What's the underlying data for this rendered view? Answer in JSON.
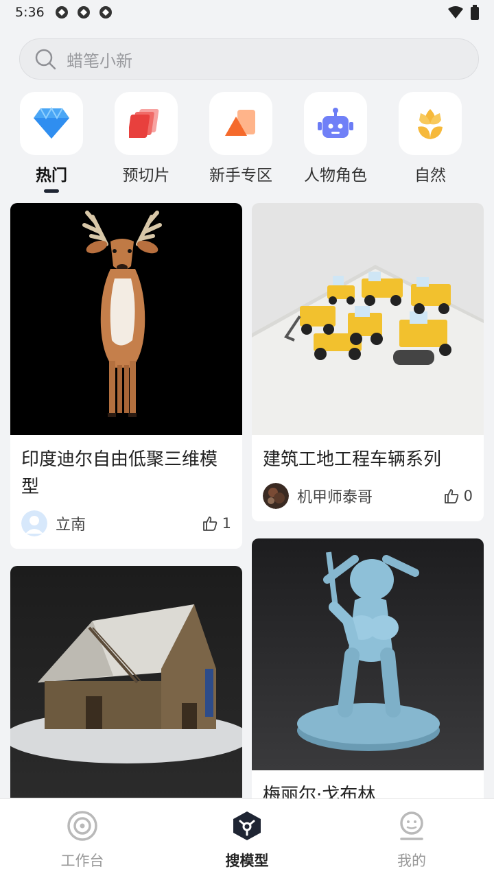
{
  "status_bar": {
    "time": "5:36"
  },
  "search": {
    "placeholder": "蜡笔小新"
  },
  "categories": [
    {
      "label": "热门",
      "icon": "diamond-icon",
      "active": true
    },
    {
      "label": "预切片",
      "icon": "slices-icon",
      "active": false
    },
    {
      "label": "新手专区",
      "icon": "cards-icon",
      "active": false
    },
    {
      "label": "人物角色",
      "icon": "robot-icon",
      "active": false
    },
    {
      "label": "自然",
      "icon": "tulip-icon",
      "active": false
    }
  ],
  "cards": [
    {
      "title": "印度迪尔自由低聚三维模型",
      "author": "立南",
      "likes": "1"
    },
    {
      "title": "建筑工地工程车辆系列",
      "author": "机甲师泰哥",
      "likes": "0"
    },
    {
      "title": "",
      "author": "",
      "likes": ""
    },
    {
      "title": "梅丽尔·戈布林",
      "author": "",
      "likes": ""
    }
  ],
  "bottom_nav": [
    {
      "label": "工作台",
      "icon": "workbench-icon",
      "active": false
    },
    {
      "label": "搜模型",
      "icon": "search-model-icon",
      "active": true
    },
    {
      "label": "我的",
      "icon": "profile-icon",
      "active": false
    }
  ],
  "colors": {
    "accent": "#1f2533",
    "background": "#f2f3f5"
  }
}
